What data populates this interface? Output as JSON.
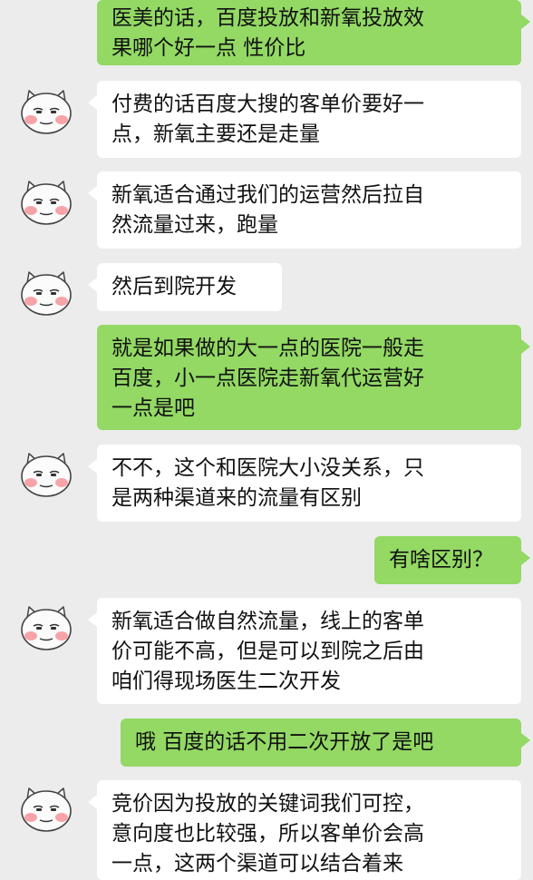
{
  "chat": {
    "messages": [
      {
        "side": "out",
        "text": "医美的话，百度投放和新氧投放效\n果哪个好一点 性价比"
      },
      {
        "side": "in",
        "text": "付费的话百度大搜的客单价要好一\n点，新氧主要还是走量"
      },
      {
        "side": "in",
        "text": "新氧适合通过我们的运营然后拉自\n然流量过来，跑量"
      },
      {
        "side": "in",
        "text": "然后到院开发"
      },
      {
        "side": "out",
        "text": "就是如果做的大一点的医院一般走\n百度，小一点医院走新氧代运营好\n一点是吧"
      },
      {
        "side": "in",
        "text": "不不，这个和医院大小没关系，只\n是两种渠道来的流量有区别"
      },
      {
        "side": "out",
        "text": "有啥区别？"
      },
      {
        "side": "in",
        "text": "新氧适合做自然流量，线上的客单\n价可能不高，但是可以到院之后由\n咱们得现场医生二次开发"
      },
      {
        "side": "out",
        "text": "哦 百度的话不用二次开放了是吧"
      },
      {
        "side": "in",
        "text": "竞价因为投放的关键词我们可控，\n意向度也比较强，所以客单价会高\n一点，这两个渠道可以结合着来"
      }
    ]
  },
  "avatar_icon": "pig-cartoon-avatar-icon",
  "colors": {
    "background": "#ececec",
    "outgoing_bubble": "#93d964",
    "incoming_bubble": "#ffffff",
    "text": "#111111"
  }
}
